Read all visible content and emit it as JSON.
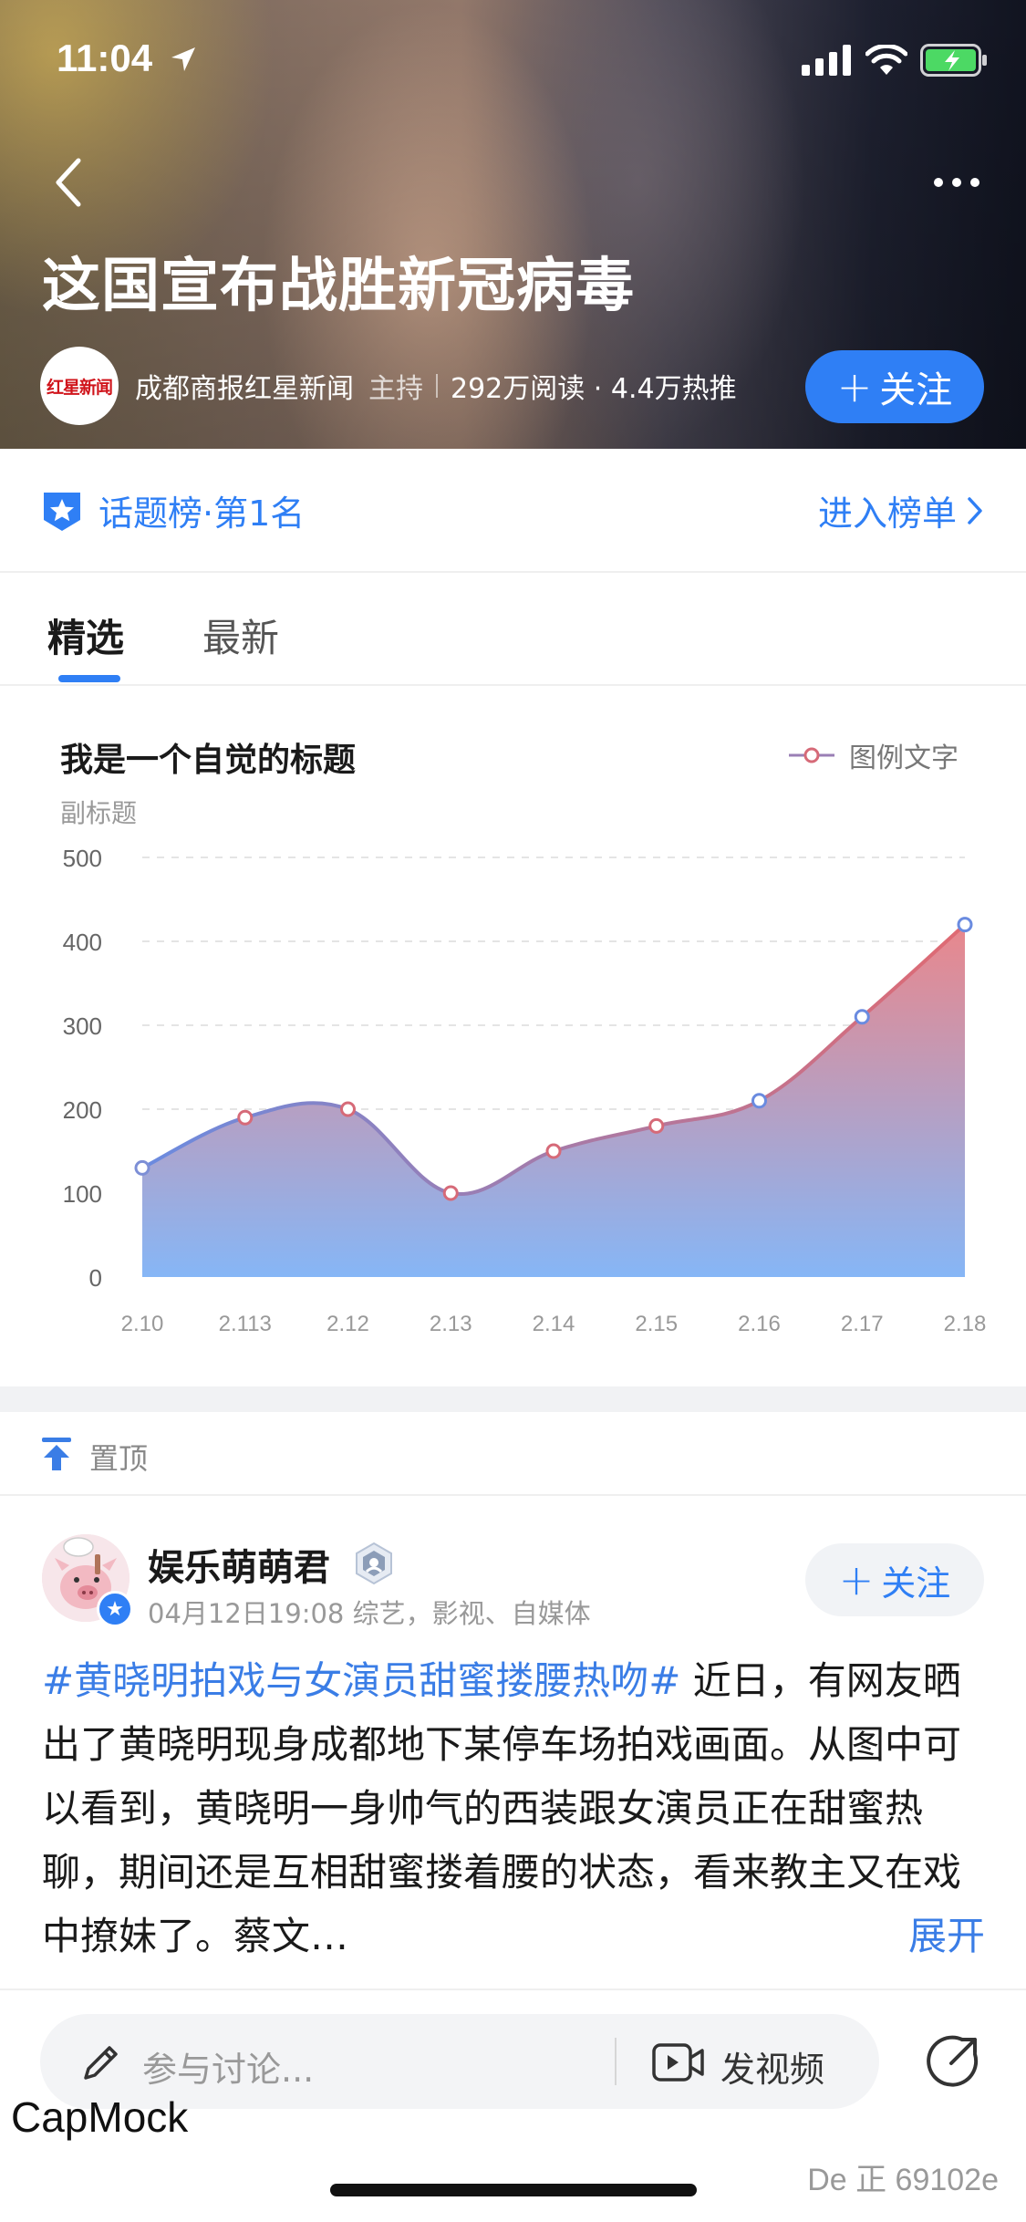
{
  "status_bar": {
    "time": "11:04"
  },
  "header": {
    "title": "这国宣布战胜新冠病毒",
    "host_logo_text": "红星新闻",
    "host_name": "成都商报红星新闻",
    "host_role": "主持",
    "stats": "292万阅读 · 4.4万热推",
    "follow_label": "关注"
  },
  "ranking": {
    "label": "话题榜·第1名",
    "link_label": "进入榜单"
  },
  "tabs": [
    {
      "label": "精选",
      "active": true
    },
    {
      "label": "最新",
      "active": false
    }
  ],
  "chart_data": {
    "type": "area",
    "title": "我是一个自觉的标题",
    "subtitle": "副标题",
    "legend": [
      "图例文字"
    ],
    "legend_position": "top-right",
    "categories": [
      "2.10",
      "2.113",
      "2.12",
      "2.13",
      "2.14",
      "2.15",
      "2.16",
      "2.17",
      "2.18"
    ],
    "series": [
      {
        "name": "图例文字",
        "values": [
          130,
          190,
          200,
          100,
          150,
          180,
          210,
          310,
          420
        ]
      }
    ],
    "y_ticks": [
      "500",
      "400",
      "300",
      "200",
      "100",
      "0"
    ],
    "ylim": [
      0,
      500
    ],
    "grid": true,
    "colors": {
      "line_start": "#6a8be0",
      "line_end": "#e06a72",
      "fill_top": "#e9878c",
      "fill_bottom": "#86b6f6"
    }
  },
  "pinned": {
    "label": "置顶"
  },
  "post": {
    "author": "娱乐萌萌君",
    "meta": "04月12日19:08 综艺，影视、自媒体",
    "follow_label": "关注",
    "hashtag": "#黄晓明拍戏与女演员甜蜜搂腰热吻#",
    "body": " 近日，有网友晒出了黄晓明现身成都地下某停车场拍戏画面。从图中可以看到，黄晓明一身帅气的西装跟女演员正在甜蜜热聊，期间还是互相甜蜜搂着腰的状态，看来教主又在戏中撩妹了。蔡文…",
    "expand_label": "展开"
  },
  "bottom_bar": {
    "comment_placeholder": "参与讨论...",
    "video_label": "发视频"
  },
  "watermarks": {
    "left": "CapMock",
    "right": "De 正 69102e"
  },
  "colors": {
    "accent": "#2f7ff5"
  }
}
